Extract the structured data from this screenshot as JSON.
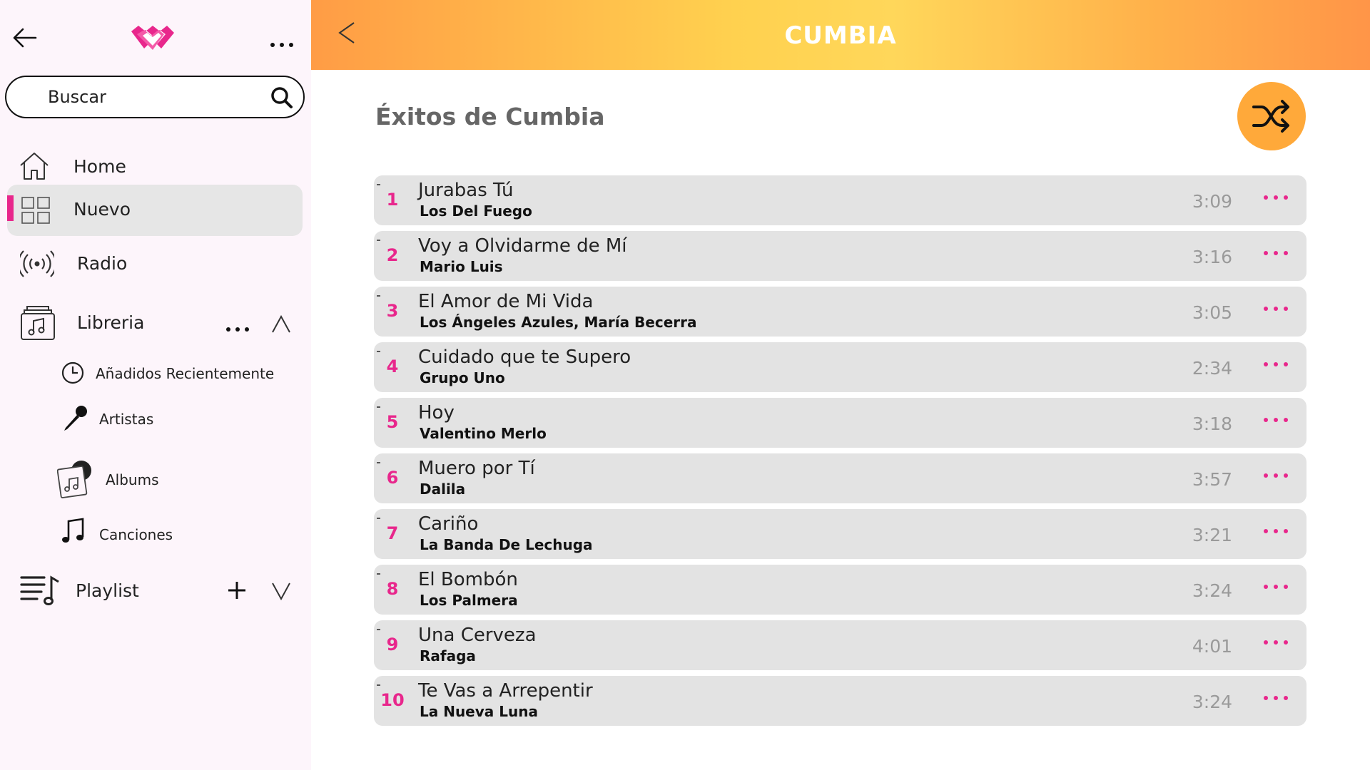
{
  "sidebar": {
    "search": {
      "placeholder": "Buscar"
    },
    "nav": {
      "home": "Home",
      "nuevo": "Nuevo",
      "radio": "Radio",
      "libreria": "Libreria",
      "playlist": "Playlist"
    },
    "library_items": {
      "recent": "Añadidos Recientemente",
      "artists": "Artistas",
      "albums": "Albums",
      "songs": "Canciones"
    },
    "active_item": "Nuevo"
  },
  "header": {
    "title": "CUMBIA"
  },
  "main": {
    "playlist_title": "Éxitos de Cumbia",
    "tracks": [
      {
        "num": "1",
        "title": "Jurabas Tú",
        "artist": "Los Del Fuego",
        "duration": "3:09"
      },
      {
        "num": "2",
        "title": "Voy a Olvidarme de Mí",
        "artist": "Mario  Luis",
        "duration": "3:16"
      },
      {
        "num": "3",
        "title": "El Amor de Mi Vida",
        "artist": "Los Ángeles Azules, María Becerra",
        "duration": "3:05"
      },
      {
        "num": "4",
        "title": "Cuidado que te Supero",
        "artist": "Grupo Uno",
        "duration": "2:34"
      },
      {
        "num": "5",
        "title": "Hoy",
        "artist": "Valentino Merlo",
        "duration": "3:18"
      },
      {
        "num": "6",
        "title": "Muero por Tí",
        "artist": "Dalila",
        "duration": "3:57"
      },
      {
        "num": "7",
        "title": "Cariño",
        "artist": "La Banda De Lechuga",
        "duration": "3:21"
      },
      {
        "num": "8",
        "title": "El Bombón",
        "artist": "Los Palmera",
        "duration": "3:24"
      },
      {
        "num": "9",
        "title": "Una Cerveza",
        "artist": "Rafaga",
        "duration": "4:01"
      },
      {
        "num": "10",
        "title": "Te Vas a Arrepentir",
        "artist": "La Nueva Luna",
        "duration": "3:24"
      }
    ]
  },
  "colors": {
    "accent": "#e8278c",
    "shuffle": "#ffa93a",
    "header_gradient": [
      "#ff9c45",
      "#ffd75a",
      "#ff9548"
    ],
    "sidebar_bg": "#fdf5fb",
    "row_bg": "#e3e3e3"
  },
  "icons": {
    "back": "arrow-left-icon",
    "logo": "app-logo",
    "more": "more-horizontal-icon",
    "search": "search-icon",
    "home": "home-icon",
    "nuevo": "grid-icon",
    "radio": "radio-broadcast-icon",
    "libreria": "library-music-icon",
    "recent": "clock-icon",
    "artists": "microphone-icon",
    "albums": "album-icon",
    "songs": "music-note-icon",
    "playlist": "playlist-icon",
    "add": "plus-icon",
    "expand": "chevron-up-icon",
    "collapse": "chevron-down-icon",
    "shuffle": "shuffle-icon"
  }
}
